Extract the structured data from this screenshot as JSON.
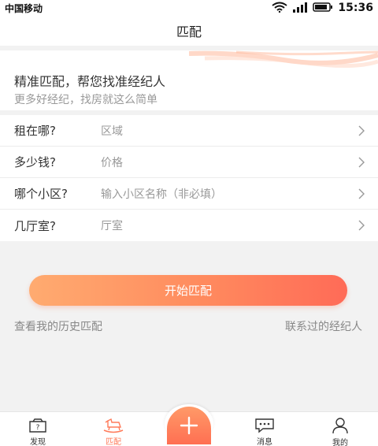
{
  "status_bar": {
    "carrier": "中国移动",
    "time": "15:36",
    "wifi_icon": "wifi-icon",
    "signal_icon": "signal-icon",
    "battery_icon": "battery-icon"
  },
  "nav": {
    "title": "匹配"
  },
  "banner": {
    "title": "精准匹配，帮您找准经纪人",
    "subtitle": "更多好经纪，找房就这么简单"
  },
  "form": {
    "rows": [
      {
        "label": "租在哪?",
        "value": "区域"
      },
      {
        "label": "多少钱?",
        "value": "价格"
      },
      {
        "label": "哪个小区?",
        "value": "输入小区名称（非必填）"
      },
      {
        "label": "几厅室?",
        "value": "厅室"
      }
    ]
  },
  "actions": {
    "start_label": "开始匹配",
    "history_label": "查看我的历史匹配",
    "contacted_label": "联系过的经纪人"
  },
  "tabs": [
    {
      "label": "发现",
      "icon": "discover-icon"
    },
    {
      "label": "匹配",
      "icon": "rocking-horse-icon",
      "active": true
    },
    {
      "label": "",
      "icon": "plus-icon"
    },
    {
      "label": "消息",
      "icon": "message-icon"
    },
    {
      "label": "我的",
      "icon": "profile-icon"
    }
  ],
  "colors": {
    "accent": "#ff7b5a",
    "button_start": "#ffab70",
    "button_end": "#ff6b57"
  }
}
